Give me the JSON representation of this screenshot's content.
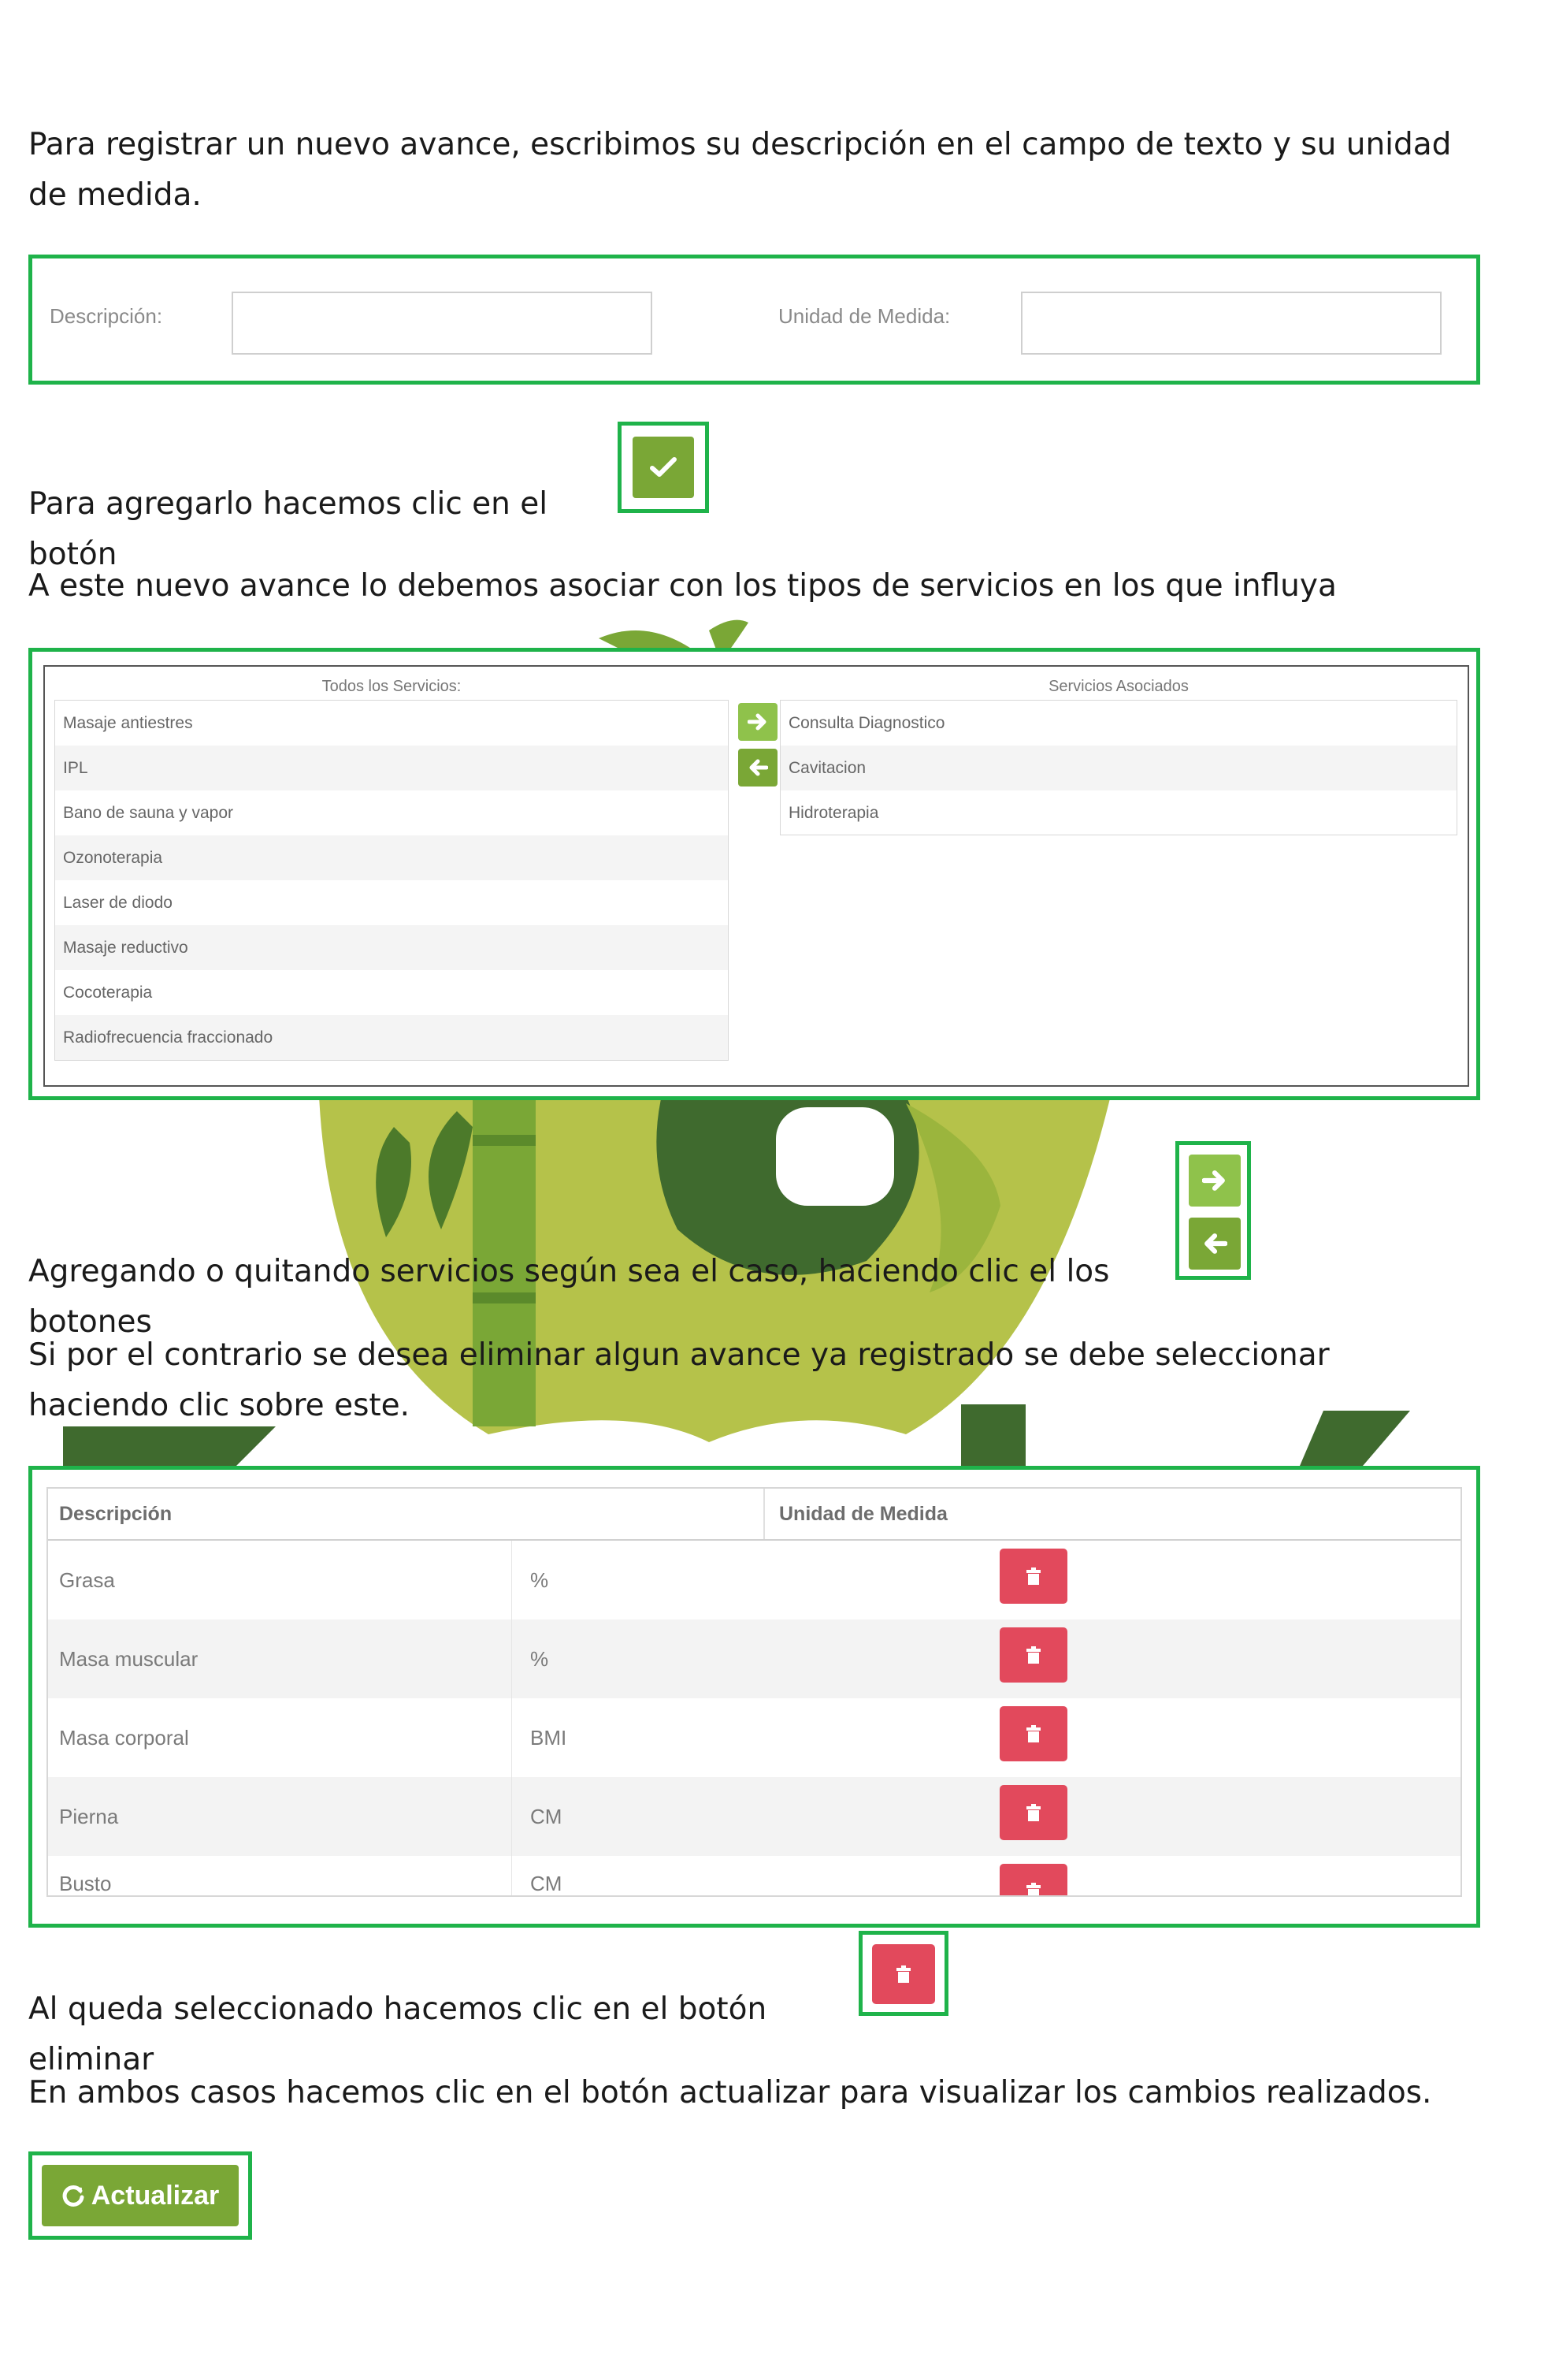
{
  "paragraphs": {
    "p1": "Para registrar un nuevo avance, escribimos su descripción en el campo de texto y su unidad de medida.",
    "p2": "Para agregarlo hacemos clic en el botón",
    "p3": "A este nuevo avance  lo debemos asociar con los tipos de servicios en los que influya",
    "p4": "Agregando o quitando servicios según sea el caso, haciendo clic el los botones",
    "p5": "Si por el contrario se desea eliminar algun avance ya registrado se debe seleccionar haciendo clic sobre este.",
    "p6": "Al queda seleccionado hacemos clic en el botón eliminar",
    "p7": "En ambos casos hacemos clic en el botón actualizar para visualizar los cambios realizados."
  },
  "form": {
    "descripcion_label": "Descripción:",
    "descripcion_value": "",
    "unidad_label": "Unidad de Medida:",
    "unidad_value": ""
  },
  "services": {
    "all_title": "Todos los Servicios:",
    "assoc_title": "Servicios Asociados",
    "all": [
      "Masaje antiestres",
      "IPL",
      "Bano de sauna y vapor",
      "Ozonoterapia",
      "Laser de diodo",
      "Masaje reductivo",
      "Cocoterapia",
      "Radiofrecuencia fraccionado"
    ],
    "associated": [
      "Consulta Diagnostico",
      "Cavitacion",
      "Hidroterapia"
    ]
  },
  "table": {
    "col_descripcion": "Descripción",
    "col_unidad": "Unidad de Medida",
    "rows": [
      {
        "descripcion": "Grasa",
        "unidad": "%"
      },
      {
        "descripcion": "Masa muscular",
        "unidad": "%"
      },
      {
        "descripcion": "Masa corporal",
        "unidad": "BMI"
      },
      {
        "descripcion": "Pierna",
        "unidad": "CM"
      },
      {
        "descripcion": "Busto",
        "unidad": "CM"
      }
    ]
  },
  "buttons": {
    "actualizar": "Actualizar"
  },
  "icons": {
    "check": "check-icon",
    "arrow_right": "arrow-right-icon",
    "arrow_left": "arrow-left-icon",
    "trash": "trash-icon",
    "refresh": "refresh-icon"
  },
  "colors": {
    "highlight_border": "#1fb34a",
    "button_green": "#7aa736",
    "delete_red": "#e2495c"
  }
}
